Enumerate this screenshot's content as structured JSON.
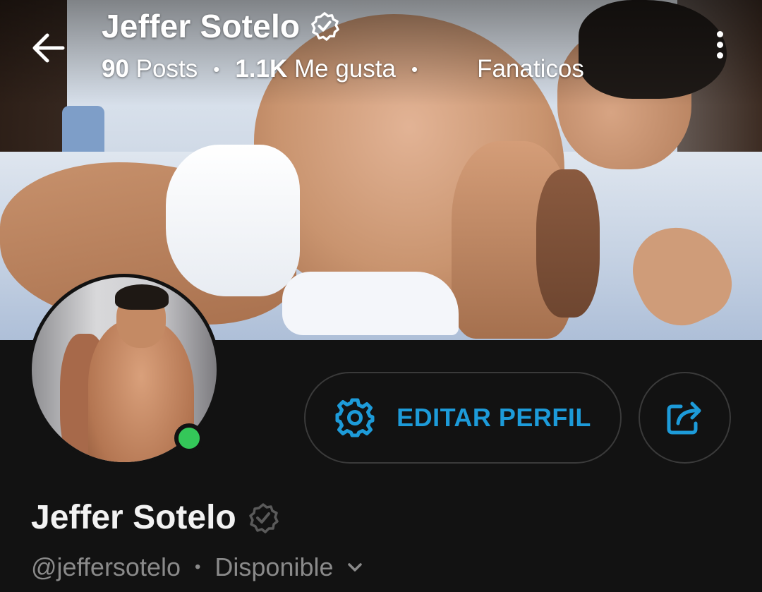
{
  "header": {
    "title": "Jeffer Sotelo",
    "posts_count": "90",
    "posts_label": "Posts",
    "likes_count": "1.1K",
    "likes_label": "Me gusta",
    "fans_label": "Fanaticos",
    "separator": "•"
  },
  "profile": {
    "display_name": "Jeffer Sotelo",
    "handle": "@jeffersotelo",
    "status": "Disponible",
    "online": true,
    "separator": "•"
  },
  "actions": {
    "edit_profile_label": "EDITAR PERFIL"
  },
  "icons": {
    "back": "arrow-left-icon",
    "more": "more-vertical-icon",
    "verified": "verified-badge-icon",
    "settings": "gear-icon",
    "share": "share-icon",
    "chevron": "chevron-down-icon"
  },
  "colors": {
    "background": "#121212",
    "accent": "#1d9bd9",
    "online": "#34c759",
    "muted_text": "#8a8a8a",
    "button_border": "#3a3a3a"
  }
}
